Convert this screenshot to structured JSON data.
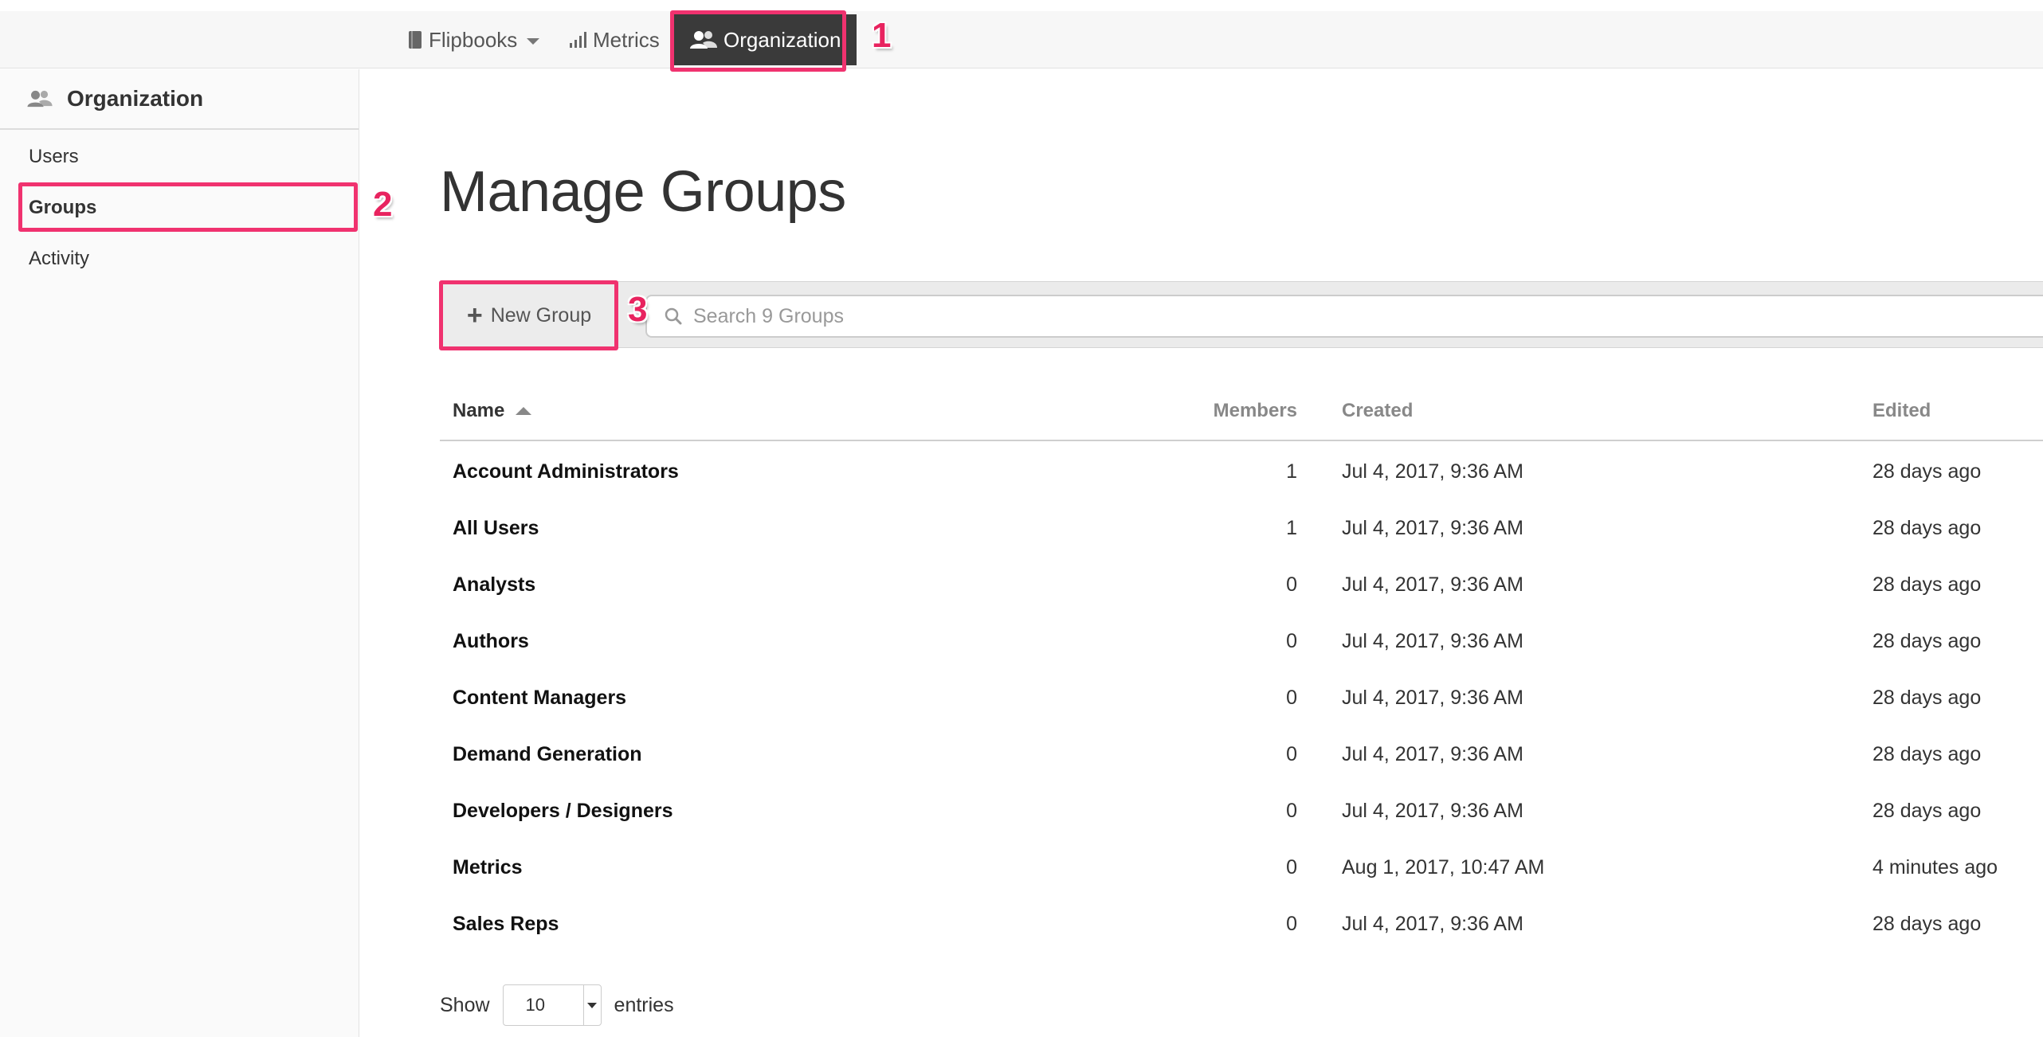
{
  "topnav": {
    "items": [
      {
        "label": "Flipbooks",
        "icon": "book-icon",
        "has_dropdown": true
      },
      {
        "label": "Metrics",
        "icon": "bar-chart-icon"
      },
      {
        "label": "Organization",
        "icon": "users-icon",
        "active": true
      }
    ]
  },
  "sidebar": {
    "header": "Organization",
    "items": [
      {
        "label": "Users"
      },
      {
        "label": "Groups",
        "active": true
      },
      {
        "label": "Activity"
      }
    ]
  },
  "callouts": [
    "1",
    "2",
    "3"
  ],
  "main": {
    "title": "Manage Groups",
    "new_group_label": "New Group",
    "search_placeholder": "Search 9 Groups"
  },
  "table": {
    "headers": {
      "name": "Name",
      "members": "Members",
      "created": "Created",
      "edited": "Edited"
    },
    "sort": {
      "column": "name",
      "direction": "asc"
    },
    "rows": [
      {
        "name": "Account Administrators",
        "members": "1",
        "created": "Jul 4, 2017, 9:36 AM",
        "edited": "28 days ago"
      },
      {
        "name": "All Users",
        "members": "1",
        "created": "Jul 4, 2017, 9:36 AM",
        "edited": "28 days ago"
      },
      {
        "name": "Analysts",
        "members": "0",
        "created": "Jul 4, 2017, 9:36 AM",
        "edited": "28 days ago"
      },
      {
        "name": "Authors",
        "members": "0",
        "created": "Jul 4, 2017, 9:36 AM",
        "edited": "28 days ago"
      },
      {
        "name": "Content Managers",
        "members": "0",
        "created": "Jul 4, 2017, 9:36 AM",
        "edited": "28 days ago"
      },
      {
        "name": "Demand Generation",
        "members": "0",
        "created": "Jul 4, 2017, 9:36 AM",
        "edited": "28 days ago"
      },
      {
        "name": "Developers / Designers",
        "members": "0",
        "created": "Jul 4, 2017, 9:36 AM",
        "edited": "28 days ago"
      },
      {
        "name": "Metrics",
        "members": "0",
        "created": "Aug 1, 2017, 10:47 AM",
        "edited": "4 minutes ago"
      },
      {
        "name": "Sales Reps",
        "members": "0",
        "created": "Jul 4, 2017, 9:36 AM",
        "edited": "28 days ago"
      }
    ]
  },
  "pagination": {
    "show_label": "Show",
    "entries_value": "10",
    "entries_label": "entries"
  },
  "colors": {
    "highlight": "#f0326f",
    "active_nav_bg": "#3a3a3a"
  }
}
